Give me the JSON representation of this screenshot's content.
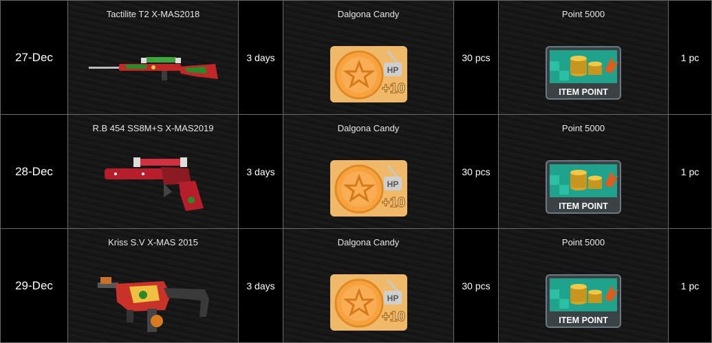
{
  "rows": [
    {
      "date": "27-Dec",
      "weapon_name": "Tactilite T2 X-MAS2018",
      "weapon_duration": "3 days",
      "candy_name": "Dalgona Candy",
      "candy_qty": "30 pcs",
      "point_name": "Point 5000",
      "point_qty": "1 pc",
      "weapon_icon": "sniper-rifle-icon"
    },
    {
      "date": "28-Dec",
      "weapon_name": "R.B 454 SS8M+S X-MAS2019",
      "weapon_duration": "3 days",
      "candy_name": "Dalgona Candy",
      "candy_qty": "30 pcs",
      "point_name": "Point 5000",
      "point_qty": "1 pc",
      "weapon_icon": "revolver-icon"
    },
    {
      "date": "29-Dec",
      "weapon_name": "Kriss S.V X-MAS 2015",
      "weapon_duration": "3 days",
      "candy_name": "Dalgona Candy",
      "candy_qty": "30 pcs",
      "point_name": "Point 5000",
      "point_qty": "1 pc",
      "weapon_icon": "smg-icon"
    }
  ],
  "candy_badge": {
    "hp": "HP",
    "plus": "+10"
  },
  "point_badge": {
    "label": "ITEM POINT"
  },
  "colors": {
    "border": "#6a6a6a",
    "candy": "#f5b15a",
    "candy_star": "#f7a23f",
    "point_green": "#1fa38d",
    "coin_gold": "#d6a428"
  }
}
